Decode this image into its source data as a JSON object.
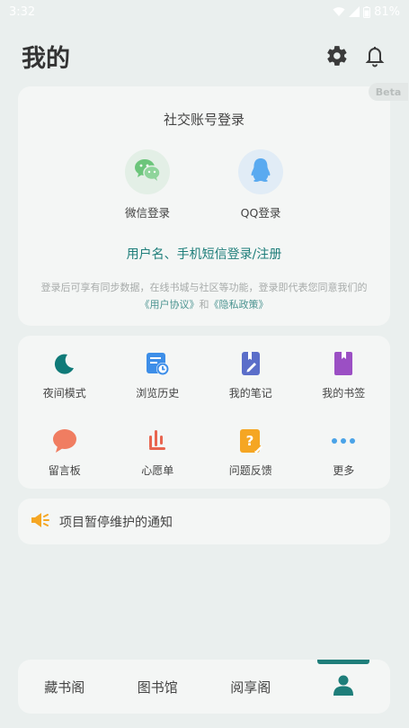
{
  "status_bar": {
    "time": "3:32",
    "battery": "81%"
  },
  "header": {
    "title": "我的"
  },
  "login": {
    "beta_badge": "Beta",
    "title": "社交账号登录",
    "wechat_label": "微信登录",
    "qq_label": "QQ登录",
    "account_link": "用户名、手机短信登录/注册",
    "notice_prefix": "登录后可享有同步数据，在线书城与社区等功能，登录即代表您同意我们的",
    "user_agreement": "《用户协议》",
    "and": "和",
    "privacy_policy": "《隐私政策》"
  },
  "grid": {
    "items": [
      {
        "label": "夜间模式",
        "icon": "moon-icon",
        "color": "#0f7a78"
      },
      {
        "label": "浏览历史",
        "icon": "history-icon",
        "color": "#3d8ee8"
      },
      {
        "label": "我的笔记",
        "icon": "notes-icon",
        "color": "#5b6ec9"
      },
      {
        "label": "我的书签",
        "icon": "bookmark-icon",
        "color": "#9b4fc4"
      },
      {
        "label": "留言板",
        "icon": "message-icon",
        "color": "#f07d61"
      },
      {
        "label": "心愿单",
        "icon": "wishlist-icon",
        "color": "#e8654f"
      },
      {
        "label": "问题反馈",
        "icon": "feedback-icon",
        "color": "#f5a623"
      },
      {
        "label": "更多",
        "icon": "more-icon",
        "color": "#4aa3e8"
      }
    ]
  },
  "announcement": {
    "text": "项目暂停维护的通知",
    "icon_color": "#f5a623"
  },
  "bottom_nav": {
    "items": [
      "藏书阁",
      "图书馆",
      "阅享阁"
    ],
    "active_icon": "user-icon",
    "active_color": "#1e7e7a"
  }
}
